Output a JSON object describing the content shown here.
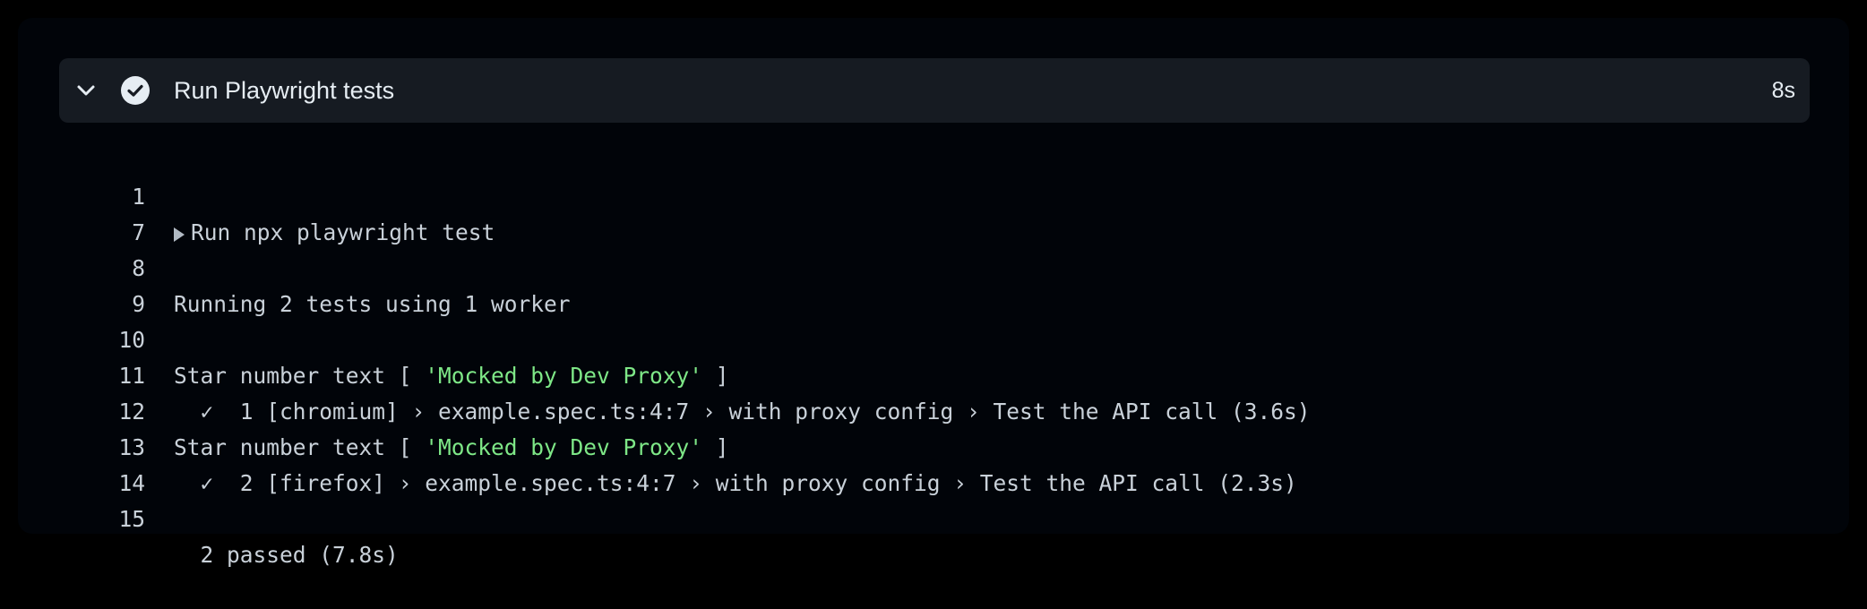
{
  "step": {
    "title": "Run Playwright tests",
    "duration": "8s",
    "status": "success"
  },
  "colors": {
    "background": "#010409",
    "header_bg": "#161b22",
    "text": "#c9d1d9",
    "string": "#7ee787"
  },
  "log": {
    "lines": [
      {
        "num": "1",
        "text": "Run npx playwright test"
      },
      {
        "num": "7",
        "text": ""
      },
      {
        "num": "8",
        "text": "Running 2 tests using 1 worker"
      },
      {
        "num": "9",
        "text": ""
      },
      {
        "num": "10",
        "pre": "Star number text [ ",
        "str": "'Mocked by Dev Proxy'",
        "post": " ]"
      },
      {
        "num": "11",
        "text": "  ✓  1 [chromium] › example.spec.ts:4:7 › with proxy config › Test the API call (3.6s)"
      },
      {
        "num": "12",
        "pre": "Star number text [ ",
        "str": "'Mocked by Dev Proxy'",
        "post": " ]"
      },
      {
        "num": "13",
        "text": "  ✓  2 [firefox] › example.spec.ts:4:7 › with proxy config › Test the API call (2.3s)"
      },
      {
        "num": "14",
        "text": ""
      },
      {
        "num": "15",
        "text": "  2 passed (7.8s)"
      }
    ]
  }
}
